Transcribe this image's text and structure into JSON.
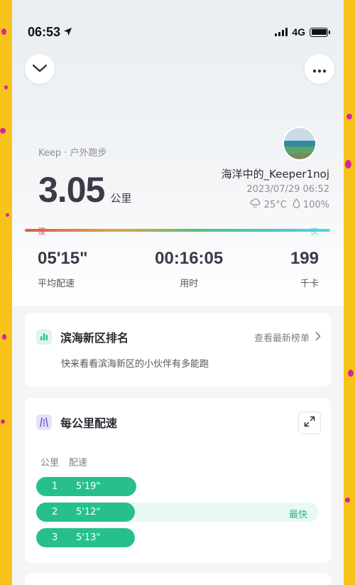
{
  "status_bar": {
    "time": "06:53",
    "network": "4G"
  },
  "header": {
    "collapse_icon": "chevron-down-icon",
    "more_icon": "more-icon"
  },
  "summary": {
    "sport_type": "Keep · 户外跑步",
    "distance": "3.05",
    "distance_unit": "公里",
    "user_name": "海洋中的_Keeper1noj",
    "datetime": "2023/07/29 06:52",
    "temperature": "25°C",
    "humidity": "100%"
  },
  "pace_scale": {
    "slow": "慢",
    "fast": "快"
  },
  "stats": [
    {
      "value": "05'15\"",
      "label": "平均配速"
    },
    {
      "value": "00:16:05",
      "label": "用时"
    },
    {
      "value": "199",
      "label": "千卡"
    }
  ],
  "ranking": {
    "title": "滨海新区排名",
    "link": "查看最新榜单",
    "description": "快来看看滨海新区的小伙伴有多能跑"
  },
  "km_pace": {
    "title": "每公里配速",
    "headers": {
      "km": "公里",
      "pace": "配速"
    },
    "rows": [
      {
        "km": "1",
        "pace": "5'19\"",
        "fraction": 0.355,
        "tag": ""
      },
      {
        "km": "2",
        "pace": "5'12\"",
        "fraction": 0.35,
        "tag": "最快"
      },
      {
        "km": "3",
        "pace": "5'13\"",
        "fraction": 0.35,
        "tag": ""
      }
    ]
  },
  "colors": {
    "accent_green": "#27c08d",
    "text_dark": "#3a3b47",
    "background": "#f5f5f7"
  }
}
